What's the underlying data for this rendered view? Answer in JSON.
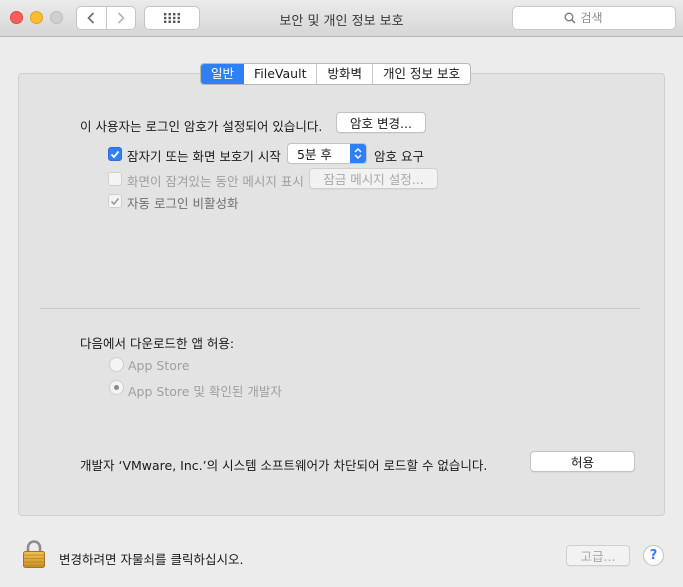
{
  "window": {
    "title": "보안 및 개인 정보 보호",
    "search_placeholder": "검색"
  },
  "tabs": [
    {
      "label": "일반",
      "active": true
    },
    {
      "label": "FileVault",
      "active": false
    },
    {
      "label": "방화벽",
      "active": false
    },
    {
      "label": "개인 정보 보호",
      "active": false
    }
  ],
  "general": {
    "password_text": "이 사용자는 로그인 암호가 설정되어 있습니다.",
    "change_password_button": "암호 변경...",
    "require_password": {
      "label": "잠자기 또는 화면 보호기 시작",
      "checked": true,
      "delay_value": "5분 후",
      "suffix": "암호 요구"
    },
    "show_message": {
      "label": "화면이 잠겨있는 동안 메시지 표시",
      "checked": false,
      "enabled": false,
      "button": "잠금 메시지 설정..."
    },
    "disable_auto_login": {
      "label": "자동 로그인 비활성화",
      "checked": true,
      "enabled": false
    }
  },
  "downloads": {
    "heading": "다음에서 다운로드한 앱 허용:",
    "options": [
      {
        "label": "App Store",
        "selected": false
      },
      {
        "label": "App Store 및 확인된 개발자",
        "selected": true
      }
    ]
  },
  "blocked": {
    "text": "개발자 ‘VMware, Inc.’의 시스템 소프트웨어가 차단되어 로드할 수 없습니다.",
    "allow_button": "허용"
  },
  "footer": {
    "lock_text": "변경하려면 자물쇠를 클릭하십시오.",
    "advanced_button": "고급...",
    "help_label": "?"
  },
  "colors": {
    "accent": "#2f80f4"
  }
}
